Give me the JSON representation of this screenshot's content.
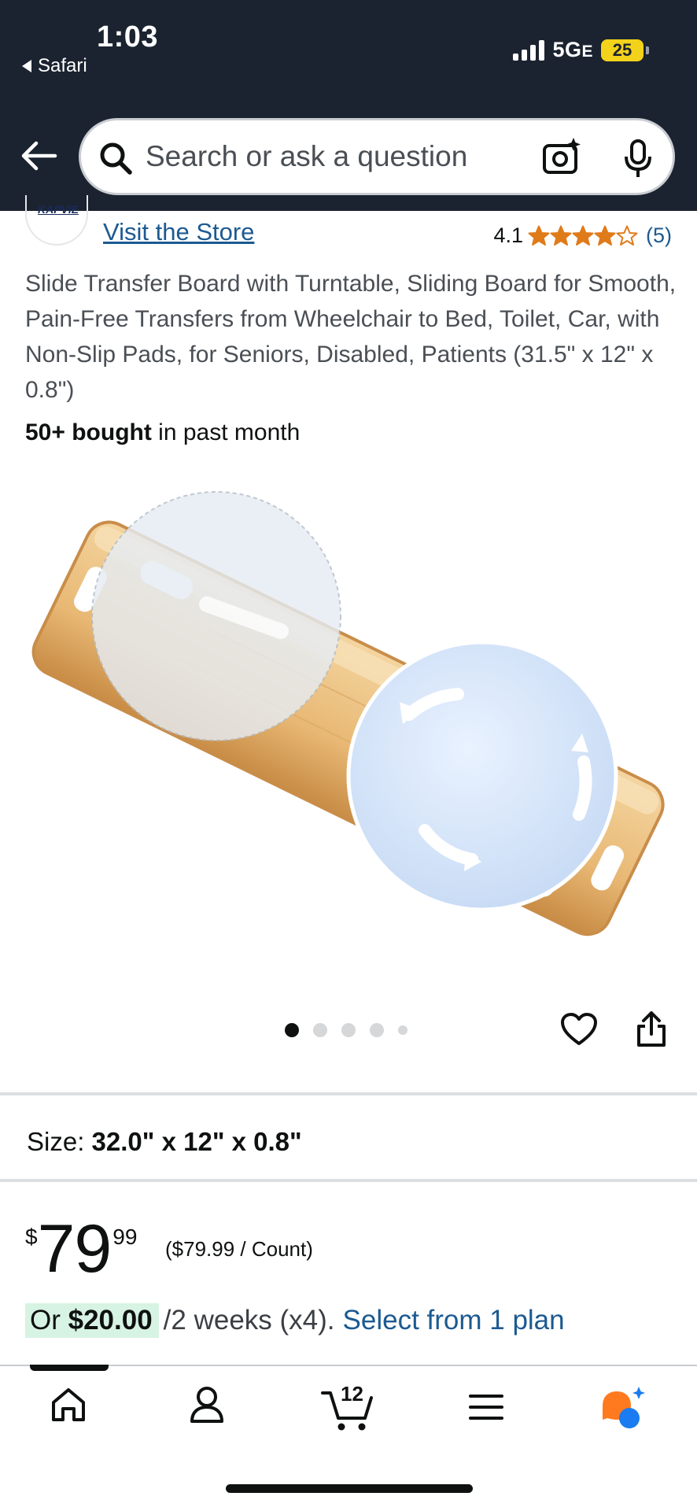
{
  "status_bar": {
    "time": "1:03",
    "back_app": "Safari",
    "network": "5G",
    "network_suffix": "E",
    "battery": "25"
  },
  "search": {
    "placeholder": "Search or ask a question"
  },
  "store": {
    "logo_text": "KAPVIE",
    "visit_label": "Visit the Store"
  },
  "rating": {
    "value": "4.1",
    "stars": 4.1,
    "count": "(5)"
  },
  "product": {
    "title": "Slide Transfer Board with Turntable, Sliding Board for Smooth, Pain-Free Transfers from Wheelchair to Bed, Toilet, Car, with Non-Slip Pads, for Seniors, Disabled, Patients (31.5\" x 12\" x 0.8\")",
    "bought_bold": "50+ bought",
    "bought_rest": " in past month",
    "image_count": 5,
    "active_image": 1
  },
  "size": {
    "label": "Size:",
    "value": "32.0\" x 12\" x 0.8\""
  },
  "price": {
    "currency": "$",
    "whole": "79",
    "fraction": "99",
    "unit_price": "($79.99 / Count)"
  },
  "installment": {
    "prefix": "Or ",
    "amount": "$20.00",
    "terms": "/2 weeks (x4).",
    "link": "Select from 1 plan"
  },
  "bottom_nav": {
    "cart_count": "12"
  },
  "colors": {
    "header_bg": "#1b2330",
    "link": "#1c5a91",
    "star": "#e07b1a",
    "installment_highlight": "#d7f3e3"
  }
}
